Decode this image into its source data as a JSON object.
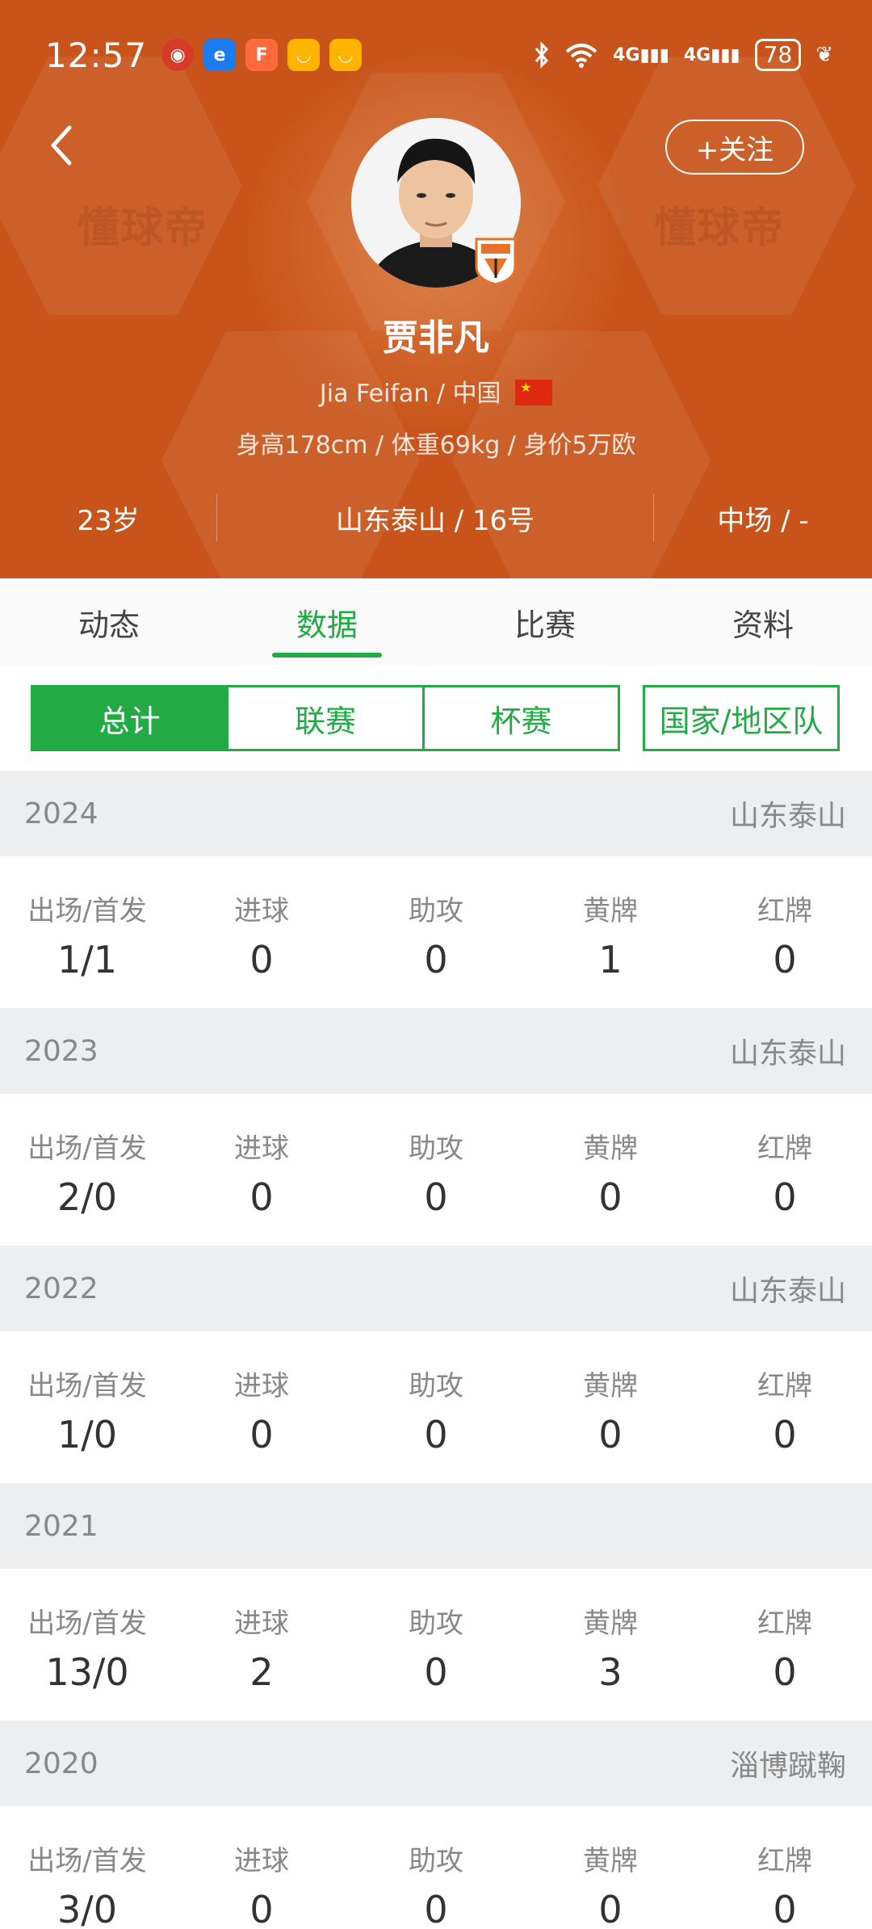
{
  "status_bar": {
    "time": "12:57",
    "battery": "78",
    "network_1": "4G",
    "network_2": "4G"
  },
  "header": {
    "follow_label": "+关注",
    "watermark": "懂球帝",
    "player_name": "贾非凡",
    "english_name": "Jia Feifan",
    "nationality": "中国",
    "body_info": "身高178cm / 体重69kg / 身价5万欧",
    "age": "23岁",
    "club_number": "山东泰山 / 16号",
    "position": "中场 / -",
    "accent_color": "#c8541b"
  },
  "tabs": [
    {
      "label": "动态"
    },
    {
      "label": "数据"
    },
    {
      "label": "比赛"
    },
    {
      "label": "资料"
    }
  ],
  "active_tab": "数据",
  "segments": [
    {
      "label": "总计"
    },
    {
      "label": "联赛"
    },
    {
      "label": "杯赛"
    },
    {
      "label": "国家/地区队"
    }
  ],
  "active_segment": "总计",
  "stat_labels": [
    "出场/首发",
    "进球",
    "助攻",
    "黄牌",
    "红牌"
  ],
  "seasons": [
    {
      "year": "2024",
      "club": "山东泰山",
      "values": [
        "1/1",
        "0",
        "0",
        "1",
        "0"
      ]
    },
    {
      "year": "2023",
      "club": "山东泰山",
      "values": [
        "2/0",
        "0",
        "0",
        "0",
        "0"
      ]
    },
    {
      "year": "2022",
      "club": "山东泰山",
      "values": [
        "1/0",
        "0",
        "0",
        "0",
        "0"
      ]
    },
    {
      "year": "2021",
      "club": "",
      "values": [
        "13/0",
        "2",
        "0",
        "3",
        "0"
      ]
    },
    {
      "year": "2020",
      "club": "淄博蹴鞠",
      "values": [
        "3/0",
        "0",
        "0",
        "0",
        "0"
      ]
    }
  ],
  "colors": {
    "green": "#22aa44",
    "header_orange": "#c8541b"
  }
}
